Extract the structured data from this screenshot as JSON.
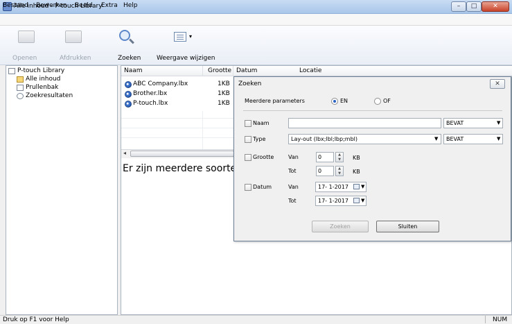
{
  "window": {
    "title": "Alle inhoud - P-touch Library",
    "close_glyph": "✕",
    "minimize_glyph": "–",
    "maximize_glyph": "□"
  },
  "menu": [
    "Bestand",
    "Bewerken",
    "Beeld",
    "Extra",
    "Help"
  ],
  "toolbar": {
    "open_label": "Openen",
    "print_label": "Afdrukken",
    "search_label": "Zoeken",
    "view_label": "Weergave wijzigen",
    "view_caret": "▾"
  },
  "tree": {
    "root": "P-touch Library",
    "items": [
      "Alle inhoud",
      "Prullenbak",
      "Zoekresultaten"
    ]
  },
  "list": {
    "columns": [
      "Naam",
      "Grootte",
      "Datum",
      "Locatie"
    ],
    "rows": [
      {
        "name": "ABC Company.lbx",
        "size": "1KB"
      },
      {
        "name": "Brother.lbx",
        "size": "1KB"
      },
      {
        "name": "P-touch.lbx",
        "size": "1KB"
      }
    ],
    "scroll_left": "◂"
  },
  "preview": {
    "text": "Er zijn meerdere soorten"
  },
  "status": {
    "help": "Druk op F1 voor Help",
    "num": "NUM"
  },
  "dialog": {
    "title": "Zoeken",
    "close_glyph": "✕",
    "params_label": "Meerdere parameters",
    "radio_and": "EN",
    "radio_or": "OF",
    "name_label": "Naam",
    "name_value": "",
    "name_op": "BEVAT",
    "type_label": "Type",
    "type_value": "Lay-out (lbx;lbl;lbp;mbl)",
    "type_op": "BEVAT",
    "size_label": "Grootte",
    "from_label": "Van",
    "to_label": "Tot",
    "size_from": "0",
    "size_to": "0",
    "size_unit": "KB",
    "date_label": "Datum",
    "date_from": "17- 1-2017",
    "date_to": "17- 1-2017",
    "search_button": "Zoeken",
    "close_button": "Sluiten",
    "combo_arrow": "▼",
    "spin_up": "▲",
    "spin_down": "▼"
  }
}
